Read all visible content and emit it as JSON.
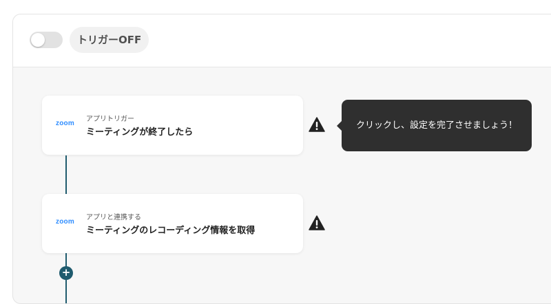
{
  "trigger": {
    "status_label": "トリガーOFF",
    "enabled": false
  },
  "steps": [
    {
      "app_icon": "zoom",
      "app_logo_text": "zoom",
      "type_label": "アプリトリガー",
      "title": "ミーティングが終了したら",
      "warning": true
    },
    {
      "app_icon": "zoom",
      "app_logo_text": "zoom",
      "type_label": "アプリと連携する",
      "title": "ミーティングのレコーディング情報を取得",
      "warning": true
    }
  ],
  "tooltip": {
    "text": "クリックし、設定を完了させましょう！"
  },
  "add_step": {
    "symbol": "+"
  },
  "colors": {
    "connector": "#1f5b6e",
    "zoom_blue": "#2d8cff",
    "tooltip_bg": "#2f2f2f",
    "toggle_off": "#e2e2e2"
  }
}
